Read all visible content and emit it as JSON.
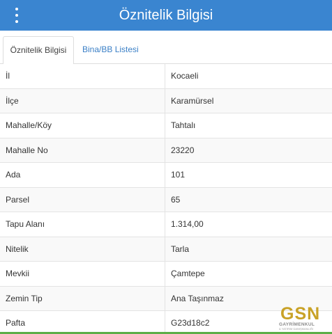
{
  "header": {
    "title": "Öznitelik Bilgisi",
    "menu_icon": "kebab-menu-icon",
    "background": "#3a85d0"
  },
  "tabs": [
    {
      "label": "Öznitelik Bilgisi",
      "active": true
    },
    {
      "label": "Bina/BB Listesi",
      "active": false
    }
  ],
  "rows": [
    {
      "label": "İl",
      "value": "Kocaeli"
    },
    {
      "label": "İlçe",
      "value": "Karamürsel"
    },
    {
      "label": "Mahalle/Köy",
      "value": "Tahtalı"
    },
    {
      "label": "Mahalle No",
      "value": "23220"
    },
    {
      "label": "Ada",
      "value": "101"
    },
    {
      "label": "Parsel",
      "value": "65"
    },
    {
      "label": "Tapu Alanı",
      "value": "1.314,00"
    },
    {
      "label": "Nitelik",
      "value": "Tarla"
    },
    {
      "label": "Mevkii",
      "value": "Çamtepe"
    },
    {
      "label": "Zemin Tip",
      "value": "Ana Taşınmaz"
    },
    {
      "label": "Pafta",
      "value": "G23d18c2"
    }
  ],
  "watermark": {
    "brand": "GSN",
    "subtitle": "GAYRİMENKUL",
    "tagline": "& YATIRIM DANIŞMANLIĞI",
    "color": "#c9a227"
  },
  "accent_bottom": "#5cae47"
}
